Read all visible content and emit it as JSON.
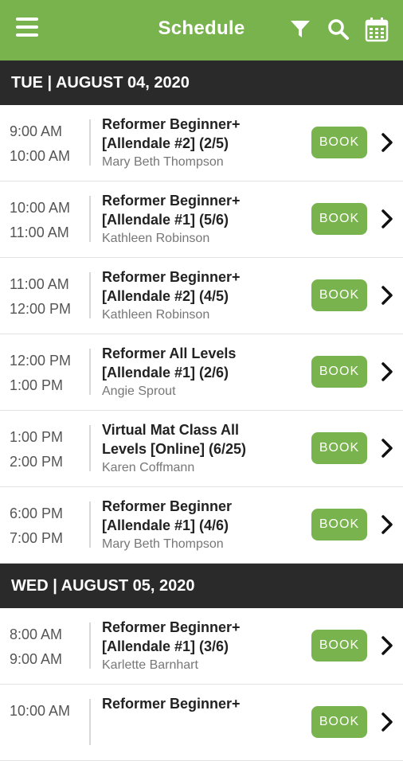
{
  "header": {
    "title": "Schedule",
    "icons": [
      "menu-icon",
      "filter-icon",
      "search-icon",
      "calendar-icon"
    ],
    "color": "#79b34e"
  },
  "days": [
    {
      "label": "TUE | AUGUST 04, 2020",
      "classes": [
        {
          "start": "9:00 AM",
          "end": "10:00 AM",
          "name_line1": "Reformer Beginner+",
          "name_line2": "[Allendale #2] (2/5)",
          "instructor": "Mary Beth Thompson",
          "button": "BOOK"
        },
        {
          "start": "10:00 AM",
          "end": "11:00 AM",
          "name_line1": "Reformer Beginner+",
          "name_line2": "[Allendale #1] (5/6)",
          "instructor": "Kathleen Robinson",
          "button": "BOOK"
        },
        {
          "start": "11:00 AM",
          "end": "12:00 PM",
          "name_line1": "Reformer Beginner+",
          "name_line2": "[Allendale #2] (4/5)",
          "instructor": "Kathleen Robinson",
          "button": "BOOK"
        },
        {
          "start": "12:00 PM",
          "end": "1:00 PM",
          "name_line1": "Reformer All Levels",
          "name_line2": "[Allendale #1] (2/6)",
          "instructor": "Angie Sprout",
          "button": "BOOK"
        },
        {
          "start": "1:00 PM",
          "end": "2:00 PM",
          "name_line1": "Virtual Mat Class All",
          "name_line2": "Levels [Online] (6/25)",
          "instructor": "Karen Coffmann",
          "button": "BOOK"
        },
        {
          "start": "6:00 PM",
          "end": "7:00 PM",
          "name_line1": "Reformer Beginner",
          "name_line2": "[Allendale #1] (4/6)",
          "instructor": "Mary Beth Thompson",
          "button": "BOOK"
        }
      ]
    },
    {
      "label": "WED | AUGUST 05, 2020",
      "classes": [
        {
          "start": "8:00 AM",
          "end": "9:00 AM",
          "name_line1": "Reformer Beginner+",
          "name_line2": "[Allendale #1] (3/6)",
          "instructor": "Karlette Barnhart",
          "button": "BOOK"
        },
        {
          "start": "10:00 AM",
          "end": "",
          "name_line1": "Reformer Beginner+",
          "name_line2": "",
          "instructor": "",
          "button": "BOOK"
        }
      ]
    }
  ]
}
